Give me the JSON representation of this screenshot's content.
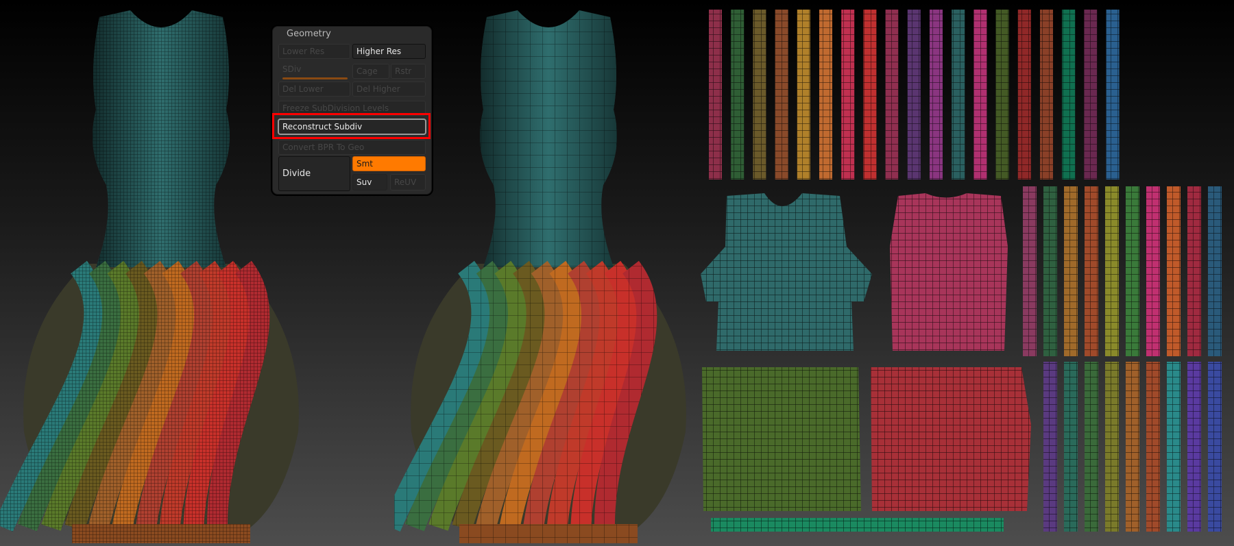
{
  "geometry_panel": {
    "title": "Geometry",
    "lower_res": "Lower Res",
    "higher_res": "Higher Res",
    "sdiv": "SDiv",
    "cage": "Cage",
    "rstr": "Rstr",
    "del_lower": "Del Lower",
    "del_higher": "Del Higher",
    "freeze": "Freeze SubDivision Levels",
    "reconstruct": "Reconstruct Subdiv",
    "convert_bpr": "Convert BPR To Geo",
    "divide": "Divide",
    "smt": "Smt",
    "suv": "Suv",
    "reuv": "ReUV"
  },
  "colors": {
    "accent": "#ff7a00",
    "highlight": "#ff0000",
    "torso": "#2f6e6e",
    "ribbons": [
      "#2a7a78",
      "#3a6e40",
      "#5a7a2a",
      "#6a5a20",
      "#a0602a",
      "#c06a20",
      "#b04030",
      "#c03a2a",
      "#c8302a",
      "#b02a30"
    ],
    "uv_strips_top": [
      "#8e2f4a",
      "#2f5e35",
      "#6b5a2a",
      "#8a4a2a",
      "#b0802a",
      "#c06a30",
      "#c03050",
      "#c03030",
      "#902f50",
      "#5a3570",
      "#8a3580",
      "#2a6060",
      "#b03070",
      "#445a25",
      "#902828",
      "#8a4028",
      "#107050",
      "#6a2850",
      "#2a6090"
    ],
    "uv_strips_right": [
      "#8a3a60",
      "#2f6040",
      "#a06a2a",
      "#a04a2a",
      "#8a8a2a",
      "#3a7a3a",
      "#c03070",
      "#c05a2a",
      "#a02a40",
      "#2a5a7a"
    ],
    "uv_strips_bottom": [
      "#5a3a80",
      "#2a6a5a",
      "#3a6a3a",
      "#7a7a2a",
      "#a0602a",
      "#a04a2a",
      "#2a8a8a",
      "#5a3aa0",
      "#3a4aa0"
    ],
    "uv_front": "#2f6a6a",
    "uv_back": "#a8355a",
    "uv_skirt_front": "#4a6a2a",
    "uv_skirt_back": "#a83038",
    "uv_hem": "#1a8a60"
  }
}
